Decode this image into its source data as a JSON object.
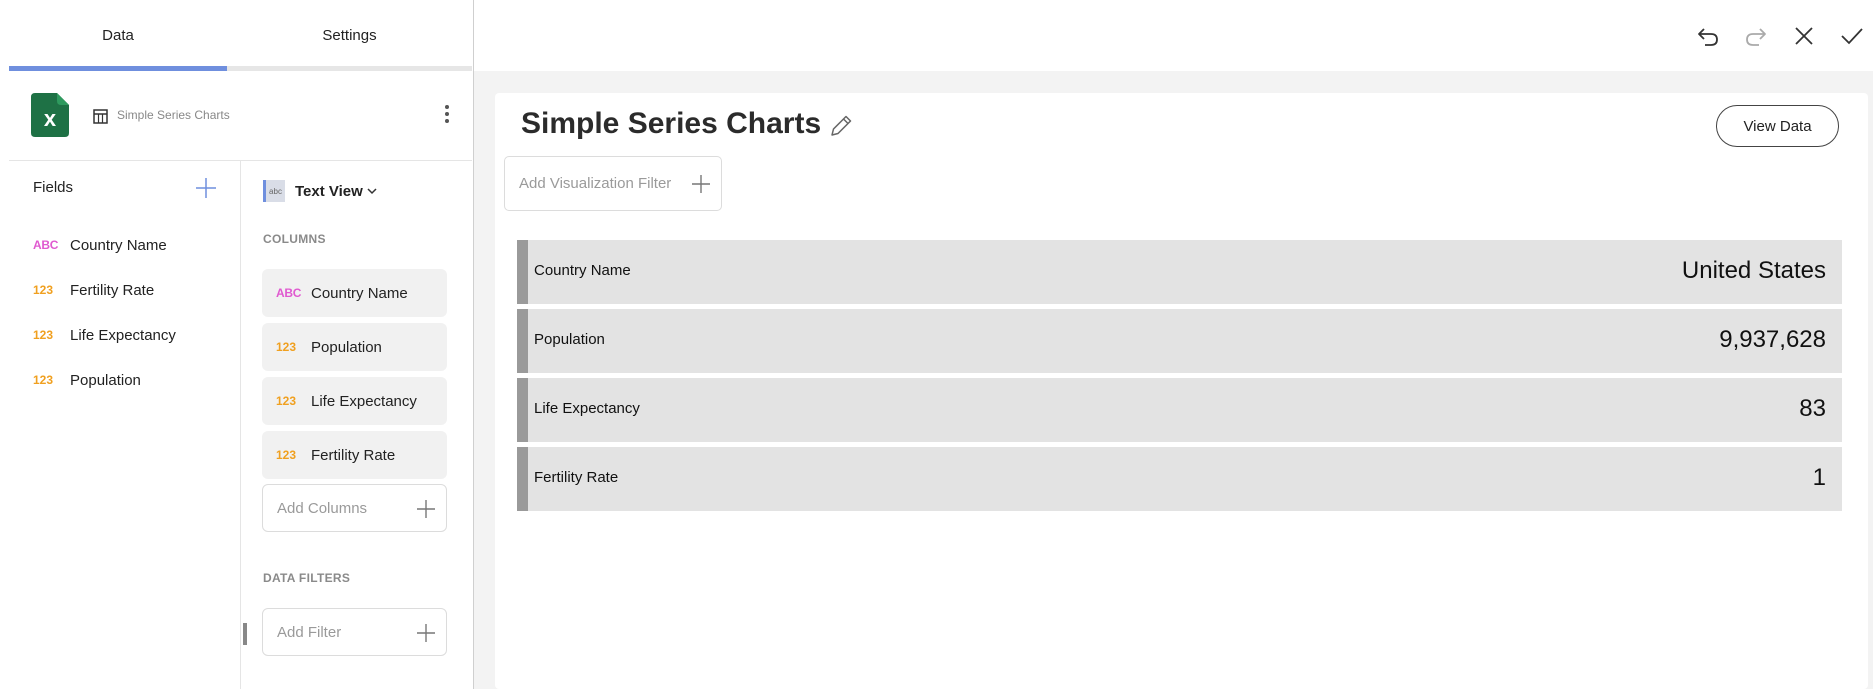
{
  "tabs": {
    "data": "Data",
    "settings": "Settings"
  },
  "source": {
    "name": "Simple Series Charts",
    "icon": "excel-icon"
  },
  "fields": {
    "title": "Fields",
    "items": [
      {
        "type": "ABC",
        "label": "Country Name"
      },
      {
        "type": "123",
        "label": "Fertility Rate"
      },
      {
        "type": "123",
        "label": "Life Expectancy"
      },
      {
        "type": "123",
        "label": "Population"
      }
    ]
  },
  "visualization": {
    "thumb": "abc",
    "type": "Text View",
    "columns_title": "COLUMNS",
    "columns": [
      {
        "type": "ABC",
        "label": "Country Name"
      },
      {
        "type": "123",
        "label": "Population"
      },
      {
        "type": "123",
        "label": "Life Expectancy"
      },
      {
        "type": "123",
        "label": "Fertility Rate"
      }
    ],
    "add_columns": "Add Columns",
    "filters_title": "DATA FILTERS",
    "add_filter": "Add Filter"
  },
  "card": {
    "title": "Simple Series Charts",
    "view_data": "View Data",
    "add_viz_filter": "Add Visualization Filter"
  },
  "text_view": [
    {
      "label": "Country Name",
      "value": "United States"
    },
    {
      "label": "Population",
      "value": "9,937,628"
    },
    {
      "label": "Life Expectancy",
      "value": "83"
    },
    {
      "label": "Fertility Rate",
      "value": "1"
    }
  ],
  "colors": {
    "accent": "#6f8fde",
    "abc_type": "#e05ad0",
    "num_type": "#f0a020",
    "excel": "#1e7145"
  }
}
